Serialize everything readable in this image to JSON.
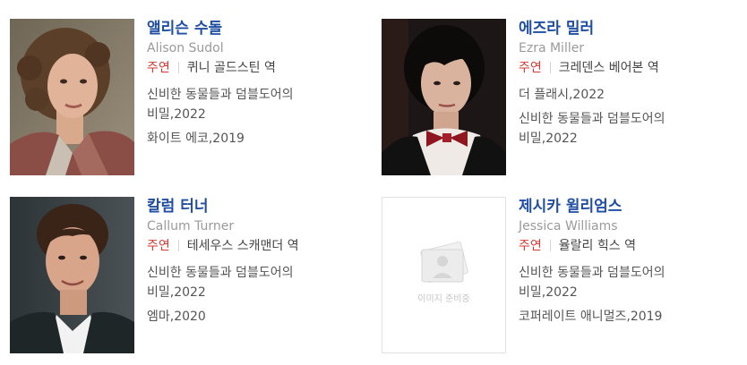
{
  "cast": [
    {
      "name_ko": "앨리슨 수돌",
      "name_en": "Alison Sudol",
      "role": "주연",
      "character": "퀴니 골드스틴 역",
      "works": [
        "신비한 동물들과 덤블도어의 비밀,2022",
        "화이트 에코,2019"
      ]
    },
    {
      "name_ko": "에즈라 밀러",
      "name_en": "Ezra Miller",
      "role": "주연",
      "character": "크레덴스 베어본 역",
      "works": [
        "더 플래시,2022",
        "신비한 동물들과 덤블도어의 비밀,2022"
      ]
    },
    {
      "name_ko": "칼럼 터너",
      "name_en": "Callum Turner",
      "role": "주연",
      "character": "테세우스 스캐맨더 역",
      "works": [
        "신비한 동물들과 덤블도어의 비밀,2022",
        "엠마,2020"
      ]
    },
    {
      "name_ko": "제시카 윌리엄스",
      "name_en": "Jessica Williams",
      "role": "주연",
      "character": "율랄리 힉스 역",
      "works": [
        "신비한 동물들과 덤블도어의 비밀,2022",
        "코퍼레이트 애니멀즈,2019"
      ],
      "placeholder_text": "이미지 준비중"
    }
  ],
  "colors": {
    "name": "#1f4ea2",
    "role": "#d23a33",
    "name_en": "#9a9a9a"
  }
}
